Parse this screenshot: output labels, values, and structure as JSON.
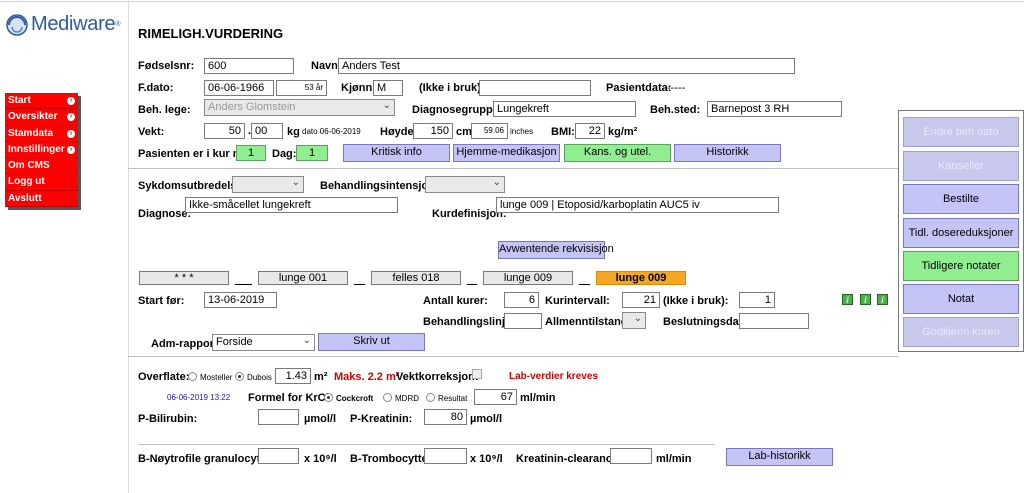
{
  "brand": {
    "name": "Mediware",
    "tm": "®"
  },
  "menu": [
    {
      "label": "Start",
      "has_arrow": true
    },
    {
      "label": "Oversikter",
      "has_arrow": true
    },
    {
      "label": "Stamdata",
      "has_arrow": true
    },
    {
      "label": "Innstillinger",
      "has_arrow": true
    },
    {
      "label": "Om CMS",
      "has_arrow": false
    },
    {
      "label": "Logg ut",
      "has_arrow": false
    },
    {
      "label": "Avslutt",
      "has_arrow": false
    }
  ],
  "page_title": "RIMELIGH.VURDERING",
  "patient": {
    "fodselsnr_label": "Fødselsnr:",
    "fodselsnr": "600",
    "navn_label": "Navn:",
    "navn": "Anders Test",
    "fdato_label": "F.dato:",
    "fdato": "06-06-1966",
    "alder": "53 år",
    "kjonn_label": "Kjønn:",
    "kjonn": "M",
    "ikke_i_bruk_label": "(Ikke i bruk):",
    "ikke_i_bruk": "",
    "pasientdata_label": "Pasientdata:",
    "pasientdata": "-----",
    "beh_lege_label": "Beh. lege:",
    "beh_lege": "Anders Glomstein",
    "diagnosegruppe_label": "Diagnosegruppe:",
    "diagnosegruppe": "Lungekreft",
    "beh_sted_label": "Beh.sted:",
    "beh_sted": "Barnepost 3 RH",
    "vekt_label": "Vekt:",
    "vekt_int": "50",
    "vekt_dec": "00",
    "vekt_unit": "kg",
    "vekt_date": "dato 06-06-2019",
    "hoyde_label": "Høyde:",
    "hoyde": "150",
    "hoyde_unit": "cm",
    "hoyde_in": "59.06",
    "hoyde_in_unit": "inches",
    "bmi_label": "BMI:",
    "bmi": "22",
    "bmi_unit": "kg/m²",
    "kur_nr_label": "Pasienten er i kur nr:",
    "kur_nr": "1",
    "dag_label": "Dag:",
    "dag": "1"
  },
  "buttons": {
    "kritisk_info": "Kritisk info",
    "hjemme_medikasjon": "Hjemme-medikasjon",
    "kans_og_utel": "Kans. og utel.",
    "historikk": "Historikk",
    "avwentende": "Avwentende rekvisisjon",
    "skriv_ut": "Skriv ut",
    "lab_historikk": "Lab-historikk"
  },
  "side_buttons": [
    {
      "label": "Endre beh dato",
      "state": "disabled"
    },
    {
      "label": "Kanseller",
      "state": "disabled"
    },
    {
      "label": "Bestilte",
      "state": "normal"
    },
    {
      "label": "Tidl. dosereduksjoner",
      "state": "normal"
    },
    {
      "label": "Tidligere notater",
      "state": "green"
    },
    {
      "label": "Notat",
      "state": "normal"
    },
    {
      "label": "Godkjenn kuren",
      "state": "disabled"
    }
  ],
  "treatment": {
    "sykdom_label": "Sykdomsutbredelse:",
    "sykdom": "",
    "intensjon_label": "Behandlingsintensjon:",
    "intensjon": "",
    "diagnose_label": "Diagnose:",
    "diagnose": "Ikke-småcellet lungekreft",
    "kurdef_label": "Kurdefinisjon:",
    "kurdef": "lunge 009 | Etoposid/karboplatin AUC5 iv"
  },
  "courses": [
    {
      "label": "* * *",
      "active": false
    },
    {
      "label": "lunge 001",
      "active": false
    },
    {
      "label": "felles 018",
      "active": false
    },
    {
      "label": "lunge 009",
      "active": false
    },
    {
      "label": "lunge 009",
      "active": true
    }
  ],
  "course_details": {
    "start_label": "Start før:",
    "start": "13-06-2019",
    "antall_label": "Antall kurer:",
    "antall": "6",
    "intervall_label": "Kurintervall:",
    "intervall": "21",
    "ikke_label": "(Ikke i bruk):",
    "ikke": "1",
    "linje_label": "Behandlingslinje:",
    "linje": "",
    "allmenn_label": "Allmenntilstand:",
    "allmenn": "",
    "beslutning_label": "Beslutningsdato:",
    "beslutning": "",
    "adm_label": "Adm-rapport:",
    "adm": "Forside"
  },
  "lab": {
    "overflate_label": "Overflate:",
    "mosteller": "Mosteller",
    "dubois": "Dubois",
    "overflate": "1.43",
    "overflate_unit": "m²",
    "maks": "Maks. 2.2 m²",
    "vektkorr_label": "Vektkorreksjon:",
    "lab_kreves": "Lab-verdier kreves",
    "timestamp": "06-06-2019 13:22",
    "krcl_label": "Formel for KrCl",
    "cockcroft": "Cockcroft",
    "mdrd": "MDRD",
    "resultat": "Resultat",
    "krcl": "67",
    "krcl_unit": "ml/min",
    "bili_label": "P-Bilirubin:",
    "bili": "",
    "bili_unit": "µmol/l",
    "krea_label": "P-Kreatinin:",
    "krea": "80",
    "krea_unit": "µmol/l",
    "noytro_label": "B-Nøytrofile granulocytter:",
    "noytro": "",
    "noytro_unit": "x 10⁹/l",
    "trombo_label": "B-Trombocytter:",
    "trombo": "",
    "trombo_unit": "x 10⁹/l",
    "kreaclear_label": "Kreatinin-clearance:",
    "kreaclear": "",
    "kreaclear_unit": "ml/min"
  },
  "colors": {
    "menu_red": "#ff0000",
    "button_lavender": "#c4c4f7",
    "button_green": "#90ee90",
    "active_course": "#f5a623",
    "warning_red": "#d40000",
    "brand_blue": "#2c5aa0"
  }
}
